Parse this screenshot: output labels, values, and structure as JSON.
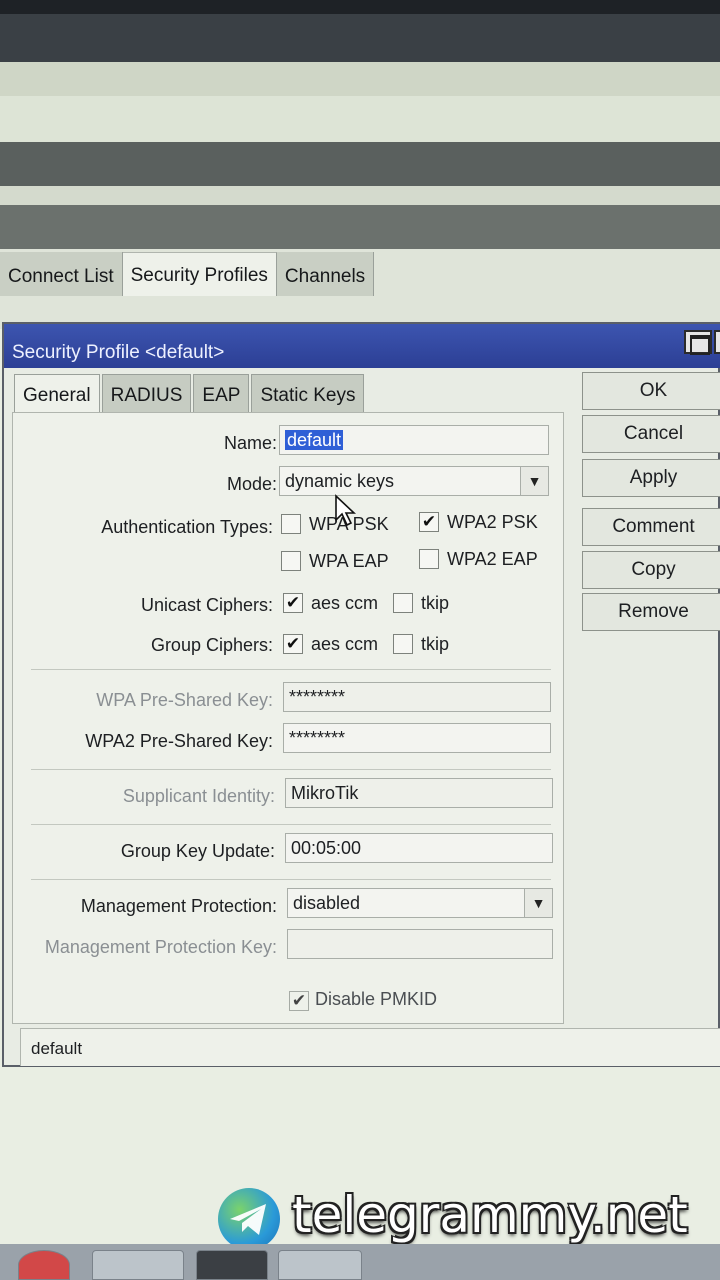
{
  "watermark": {
    "text": "telegrammy.net"
  },
  "parent_tabs": [
    {
      "label": "Connect List"
    },
    {
      "label": "Security Profiles"
    },
    {
      "label": "Channels"
    }
  ],
  "dialog": {
    "title": "Security Profile <default>",
    "tabs": [
      {
        "label": "General"
      },
      {
        "label": "RADIUS"
      },
      {
        "label": "EAP"
      },
      {
        "label": "Static Keys"
      }
    ],
    "form": {
      "name_label": "Name:",
      "name_value": "default",
      "mode_label": "Mode:",
      "mode_value": "dynamic keys",
      "auth_label": "Authentication Types:",
      "auth_wpa_psk": "WPA PSK",
      "auth_wpa2_psk": "WPA2 PSK",
      "auth_wpa_eap": "WPA EAP",
      "auth_wpa2_eap": "WPA2 EAP",
      "unicast_label": "Unicast Ciphers:",
      "group_label": "Group Ciphers:",
      "cipher_aes": "aes ccm",
      "cipher_tkip": "tkip",
      "wpa_key_label": "WPA Pre-Shared Key:",
      "wpa_key_value": "********",
      "wpa2_key_label": "WPA2 Pre-Shared Key:",
      "wpa2_key_value": "********",
      "supplicant_label": "Supplicant Identity:",
      "supplicant_value": "MikroTik",
      "gku_label": "Group Key Update:",
      "gku_value": "00:05:00",
      "mgmt_label": "Management Protection:",
      "mgmt_value": "disabled",
      "mgmt_key_label": "Management Protection Key:",
      "disable_pmkid": "Disable PMKID",
      "checked_glyph": "✔",
      "dropdown_glyph": "▼"
    },
    "buttons": {
      "ok": "OK",
      "cancel": "Cancel",
      "apply": "Apply",
      "comment": "Comment",
      "copy": "Copy",
      "remove": "Remove"
    },
    "status": "default"
  }
}
